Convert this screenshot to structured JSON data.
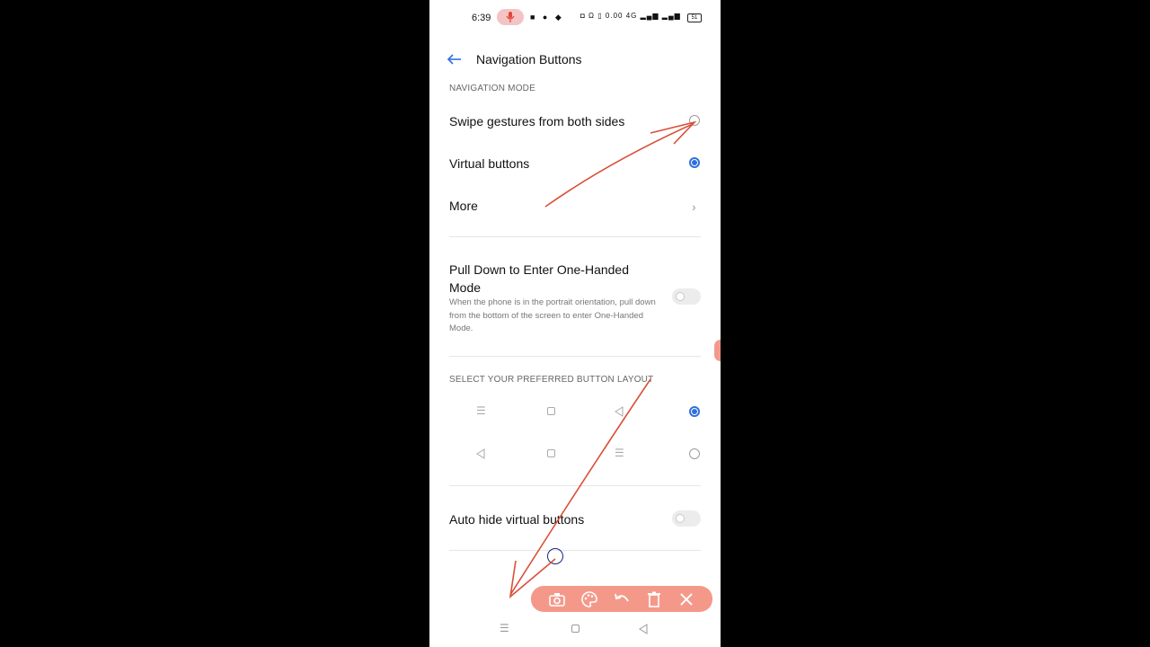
{
  "status_bar": {
    "time": "6:39",
    "data_speed": "0.00",
    "network": "4G",
    "battery": "51"
  },
  "header": {
    "title": "Navigation Buttons"
  },
  "navigation_mode": {
    "section_label": "NAVIGATION MODE",
    "options": [
      {
        "label": "Swipe gestures from both sides",
        "selected": false
      },
      {
        "label": "Virtual buttons",
        "selected": true
      }
    ],
    "more_label": "More"
  },
  "one_handed": {
    "title": "Pull Down to Enter One-Handed Mode",
    "description": "When the phone is in the portrait orientation, pull down from the bottom of the screen to enter One-Handed Mode.",
    "enabled": false
  },
  "button_layout": {
    "section_label": "SELECT YOUR PREFERRED BUTTON LAYOUT",
    "layouts": [
      {
        "buttons": [
          "menu-icon",
          "home-icon",
          "back-icon"
        ],
        "selected": true
      },
      {
        "buttons": [
          "back-icon",
          "home-icon",
          "menu-icon"
        ],
        "selected": false
      }
    ]
  },
  "auto_hide": {
    "label": "Auto hide virtual buttons",
    "enabled": false
  },
  "toolbar": {
    "buttons": [
      "camera-icon",
      "palette-icon",
      "undo-icon",
      "trash-icon",
      "close-icon"
    ]
  },
  "colors": {
    "accent": "#2f6fe0",
    "annotation": "#d9503a",
    "toolbar": "#f4998a"
  }
}
